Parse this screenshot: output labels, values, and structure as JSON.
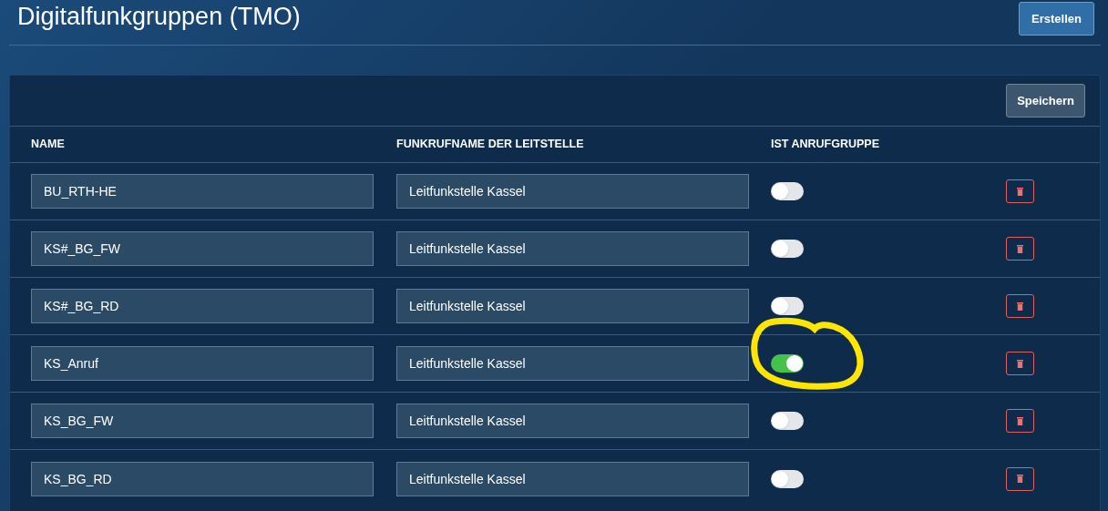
{
  "page": {
    "title": "Digitalfunkgruppen (TMO)",
    "create_button": "Erstellen"
  },
  "panel": {
    "save_button": "Speichern"
  },
  "table": {
    "columns": [
      "NAME",
      "FUNKRUFNAME DER LEITSTELLE",
      "IST ANRUFGRUPPE"
    ],
    "rows": [
      {
        "name": "BU_RTH-HE",
        "dispatch_call_sign": "Leitfunkstelle Kassel",
        "on": false,
        "circled": false
      },
      {
        "name": "KS#_BG_FW",
        "dispatch_call_sign": "Leitfunkstelle Kassel",
        "on": false,
        "circled": false
      },
      {
        "name": "KS#_BG_RD",
        "dispatch_call_sign": "Leitfunkstelle Kassel",
        "on": false,
        "circled": false
      },
      {
        "name": "KS_Anruf",
        "dispatch_call_sign": "Leitfunkstelle Kassel",
        "on": true,
        "circled": true
      },
      {
        "name": "KS_BG_FW",
        "dispatch_call_sign": "Leitfunkstelle Kassel",
        "on": false,
        "circled": false
      },
      {
        "name": "KS_BG_RD",
        "dispatch_call_sign": "Leitfunkstelle Kassel",
        "on": false,
        "circled": false
      }
    ]
  }
}
